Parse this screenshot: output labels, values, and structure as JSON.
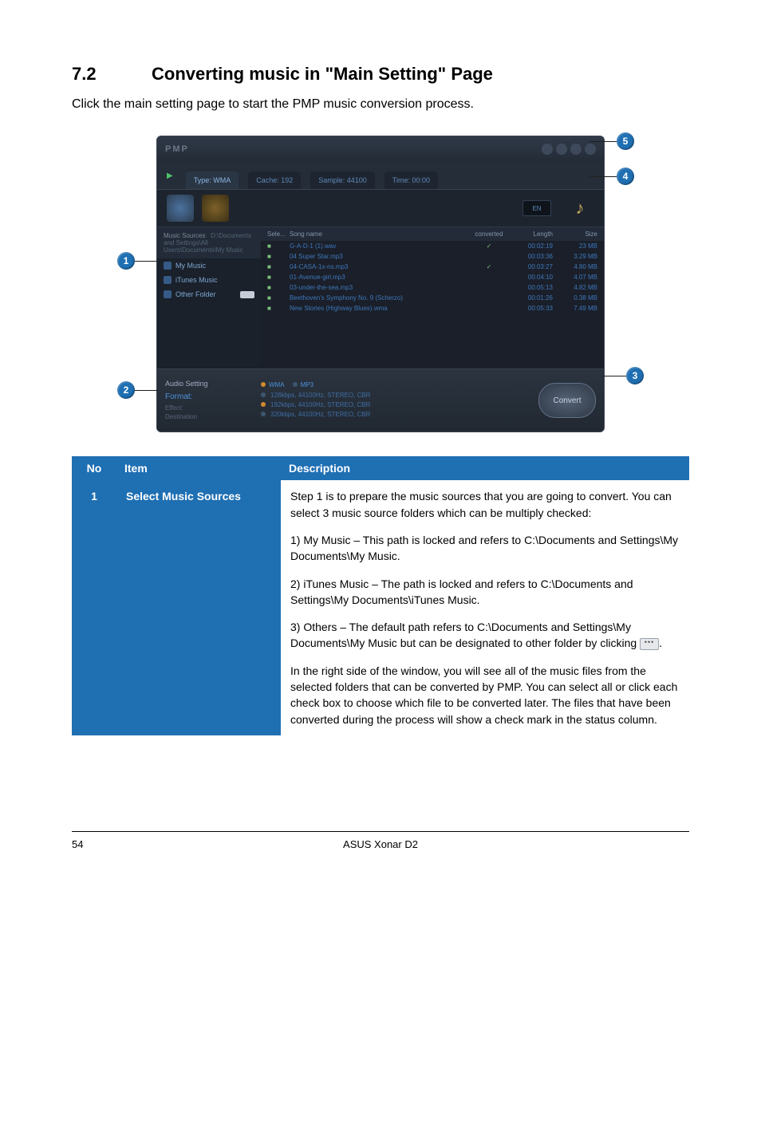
{
  "heading": {
    "num": "7.2",
    "title": "Converting music in \"Main Setting\" Page"
  },
  "intro": "Click the main setting page to start the PMP music conversion process.",
  "callouts": {
    "n1": "1",
    "n2": "2",
    "n3": "3",
    "n4": "4",
    "n5": "5"
  },
  "shot": {
    "logo": "PMP",
    "tabs": {
      "type": "Type: WMA",
      "cache": "Cache: 192",
      "sample": "Sample: 44100",
      "time": "Time: 00:00"
    },
    "en": "EN",
    "side": {
      "head": "Music Sources",
      "path": "D:\\Documents and Settings\\All Users\\Documents\\My Music",
      "items": [
        "My Music",
        "iTunes Music",
        "Other Folder"
      ]
    },
    "list": {
      "head": {
        "sel": "Sele...",
        "name": "Song name",
        "conv": "converted",
        "len": "Length",
        "size": "Size"
      },
      "rows": [
        {
          "chk": true,
          "name": "G-A-D-1 (1).wav",
          "conv": "✓",
          "len": "00:02:19",
          "size": "23 MB"
        },
        {
          "chk": true,
          "name": "04 Super Star.mp3",
          "conv": "",
          "len": "00:03:36",
          "size": "3.29 MB"
        },
        {
          "chk": true,
          "name": "04-CASA-1x-ns.mp3",
          "conv": "✓",
          "len": "00:03:27",
          "size": "4.80 MB"
        },
        {
          "chk": true,
          "name": "01-Avenue-girl.mp3",
          "conv": "",
          "len": "00:04:10",
          "size": "4.07 MB"
        },
        {
          "chk": true,
          "name": "03-under-the-sea.mp3",
          "conv": "",
          "len": "00:05:13",
          "size": "4.82 MB"
        },
        {
          "chk": true,
          "name": "Beethoven's Symphony No. 9 (Scherzo)",
          "conv": "",
          "len": "00:01:26",
          "size": "0.38 MB"
        },
        {
          "chk": true,
          "name": "New Stories (Highway Blues).wma",
          "conv": "",
          "len": "00:05:33",
          "size": "7.49 MB"
        }
      ]
    },
    "bottom": {
      "group": "Audio Setting",
      "format": "Format:",
      "effect": "Effect:",
      "dest": "Destination",
      "opts": [
        "128kbps, 44100Hz, STEREO, CBR",
        "192kbps, 44100Hz, STEREO, CBR",
        "320kbps, 44100Hz, STEREO, CBR"
      ],
      "sel_opt": 1,
      "radios": [
        "WMA",
        "MP3"
      ],
      "convert": "Convert"
    }
  },
  "table": {
    "head": {
      "no": "No",
      "item": "Item",
      "desc": "Description"
    },
    "rows": [
      {
        "no": "1",
        "item": "Select Music Sources",
        "paras": [
          "Step 1 is to prepare the music sources that you are going to convert. You can select 3 music source folders which can be multiply checked:",
          "1) My Music – This path is locked and refers to C:\\Documents and Settings\\My Documents\\My Music.",
          "2) iTunes Music – The path is locked and refers to C:\\Documents and Settings\\My Documents\\iTunes Music.",
          "3) Others – The default path refers to C:\\Documents and Settings\\My Documents\\My Music but can be designated to other folder by clicking ",
          "In the right side of the window, you will see all of the music files from the selected folders that can be converted by PMP. You can select all or click each check box to choose which file to be converted later. The files that have been converted during the process will show a check mark in the status column."
        ],
        "dots_after_para_index": 3
      }
    ]
  },
  "footer": {
    "page": "54",
    "product": "ASUS Xonar D2"
  }
}
